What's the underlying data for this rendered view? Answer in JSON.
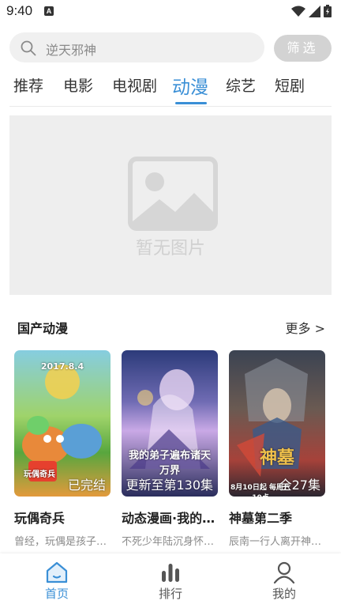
{
  "status_bar": {
    "time": "9:40",
    "notification_letter": "A"
  },
  "search": {
    "placeholder": "逆天邪神",
    "filter_label": "筛选"
  },
  "tabs": [
    {
      "label": "推荐"
    },
    {
      "label": "电影"
    },
    {
      "label": "电视剧"
    },
    {
      "label": "动漫",
      "active": true
    },
    {
      "label": "综艺"
    },
    {
      "label": "短剧"
    }
  ],
  "banner": {
    "empty_text": "暂无图片",
    "icon": "image-placeholder-icon"
  },
  "section": {
    "title": "国产动漫",
    "more_label": "更多 >"
  },
  "cards": [
    {
      "title": "玩偶奇兵",
      "desc": "曾经，玩偶是孩子们最好的玩伴",
      "badge": "已完结",
      "poster_caption": "2017.8.4",
      "poster_name": "玩偶奇兵",
      "colors": [
        "#7fc6d8",
        "#6fb84a",
        "#f0a53a"
      ]
    },
    {
      "title": "动态漫画·我的弟子遍布诸天万界",
      "desc": "不死少年陆沉身怀神秘系统",
      "badge": "更新至第130集",
      "poster_name": "我的弟子遍布诸天万界",
      "colors": [
        "#3a4a8a",
        "#b894d6",
        "#2a2d5c"
      ]
    },
    {
      "title": "神墓第二季",
      "desc": "辰南一行人离开神墓后",
      "badge": "全27集",
      "poster_caption": "8月10日起 每周六10点",
      "poster_name": "神墓",
      "colors": [
        "#2b2f3a",
        "#8a4a3a",
        "#c24a3a"
      ]
    }
  ],
  "bottom_nav": [
    {
      "label": "首页",
      "icon": "home-icon",
      "active": true
    },
    {
      "label": "排行",
      "icon": "ranking-icon"
    },
    {
      "label": "我的",
      "icon": "profile-icon"
    }
  ],
  "accent_color": "#3a8fd6"
}
